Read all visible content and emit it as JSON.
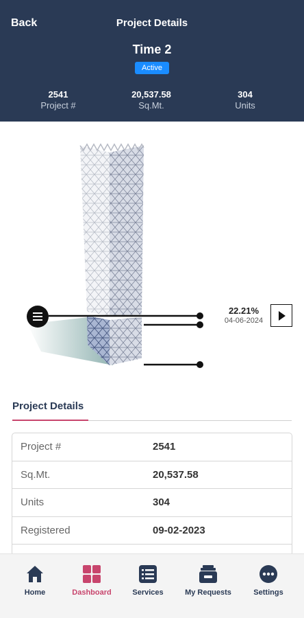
{
  "header": {
    "back_label": "Back",
    "title": "Project Details",
    "project_name": "Time 2",
    "status_badge": "Active",
    "stats": [
      {
        "value": "2541",
        "label": "Project #"
      },
      {
        "value": "20,537.58",
        "label": "Sq.Mt."
      },
      {
        "value": "304",
        "label": "Units"
      }
    ]
  },
  "progress": {
    "percent": "22.21%",
    "date": "04-06-2024"
  },
  "details": {
    "tab_label": "Project Details",
    "rows": [
      {
        "key": "Project #",
        "value": "2541"
      },
      {
        "key": "Sq.Mt.",
        "value": "20,537.58"
      },
      {
        "key": "Units",
        "value": "304"
      },
      {
        "key": "Registered",
        "value": "09-02-2023"
      }
    ]
  },
  "nav": {
    "items": [
      {
        "label": "Home",
        "icon": "home-icon"
      },
      {
        "label": "Dashboard",
        "icon": "dashboard-icon"
      },
      {
        "label": "Services",
        "icon": "services-icon"
      },
      {
        "label": "My Requests",
        "icon": "requests-icon"
      },
      {
        "label": "Settings",
        "icon": "settings-icon"
      }
    ],
    "active": "Dashboard"
  },
  "colors": {
    "header_bg": "#2a3a55",
    "badge": "#1a8cff",
    "accent": "#c8456d"
  }
}
